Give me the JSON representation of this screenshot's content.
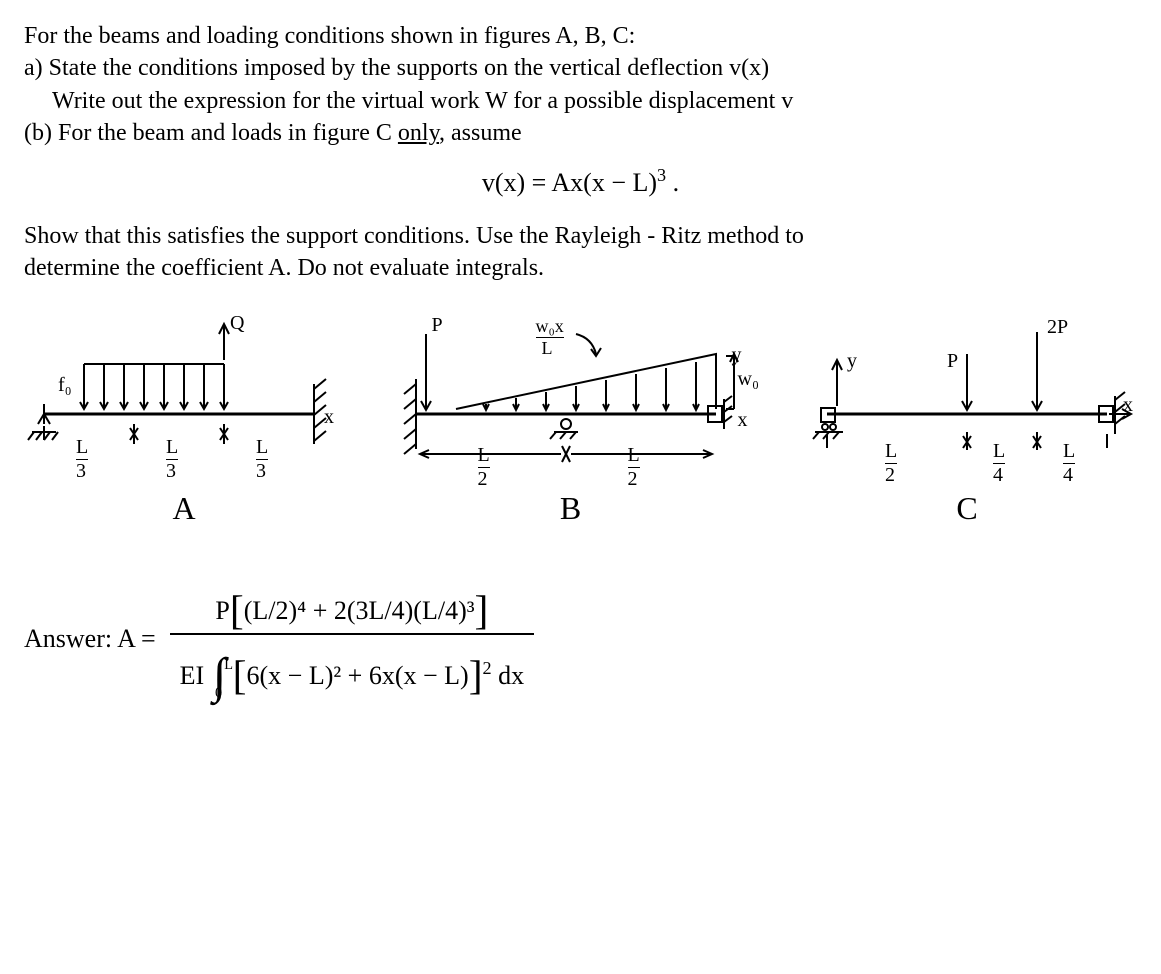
{
  "problem": {
    "intro": "For the beams and loading conditions shown in  figures A, B, C:",
    "part_a_l1": "a)  State the conditions imposed by the supports on the vertical deflection  v(x)",
    "part_a_l2": "Write out the expression for the virtual work W for a possible displacement v",
    "part_b": "(b) For the beam and loads in figure C ",
    "only": "only",
    "assume": ", assume",
    "vx_eq": "v(x) = Ax(x − L)",
    "vx_exp": "3",
    "vx_dot": "  .",
    "show_l1": "Show that this satisfies the support conditions. Use the Rayleigh - Ritz method to",
    "show_l2": "determine the coefficient  A. Do not evaluate integrals."
  },
  "figures": {
    "A": {
      "label": "A",
      "load_distributed": "f₀",
      "load_point": "Q",
      "seg1": "L/3",
      "seg2": "L/3",
      "seg3": "L/3",
      "axis": "x"
    },
    "B": {
      "label": "B",
      "load_point": "P",
      "load_tri": "w₀x / L",
      "load_tri_end": "w₀",
      "seg1": "L/2",
      "seg2": "L/2",
      "axis": "x",
      "axis_y": "y"
    },
    "C": {
      "label": "C",
      "load_p": "P",
      "load_2p": "2P",
      "axis_y": "y",
      "seg1": "L/2",
      "seg2": "L/4",
      "seg3": "L/4",
      "axis": "x"
    }
  },
  "answer": {
    "label": "Answer:   A =",
    "num_P": "P",
    "num_body": "(L/2)⁴ + 2(3L/4)(L/4)³",
    "den_EI": "EI",
    "den_int_lower": "0",
    "den_int_upper": "L",
    "den_inner": "6(x − L)² + 6x(x − L)",
    "den_outer_exp": "2",
    "den_dx": "dx"
  }
}
